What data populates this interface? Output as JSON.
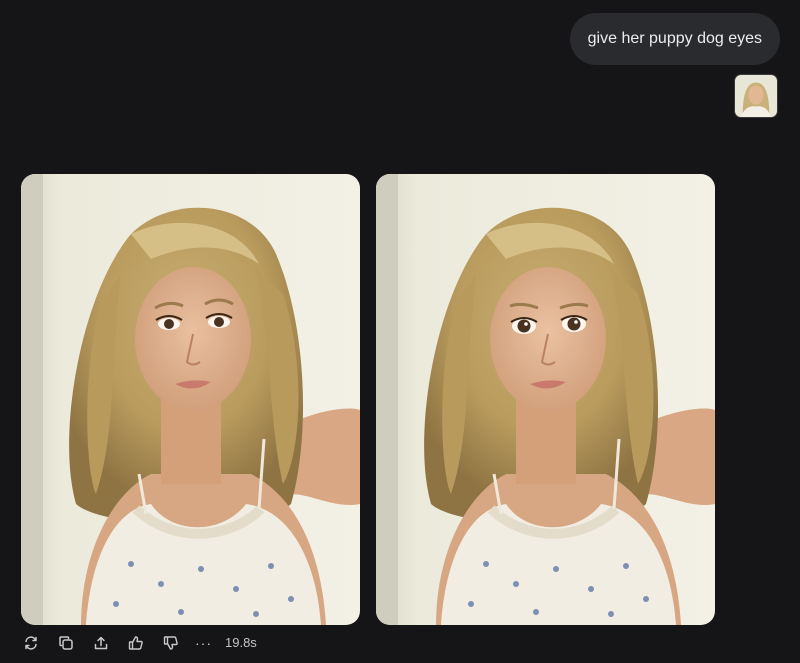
{
  "conversation": {
    "user_message": "give her puppy dog eyes",
    "attachment": {
      "kind": "image",
      "subject": "portrait-photo"
    }
  },
  "response": {
    "images": [
      {
        "subject": "portrait-photo-original"
      },
      {
        "subject": "portrait-photo-edited"
      }
    ],
    "actions": [
      {
        "icon": "regenerate-icon"
      },
      {
        "icon": "copy-icon"
      },
      {
        "icon": "share-icon"
      },
      {
        "icon": "thumbs-up-icon"
      },
      {
        "icon": "thumbs-down-icon"
      }
    ],
    "more_label": "···",
    "duration": "19.8s"
  },
  "colors": {
    "background": "#151517",
    "bubble": "#2a2b2e",
    "icon": "#c9c9cc"
  }
}
